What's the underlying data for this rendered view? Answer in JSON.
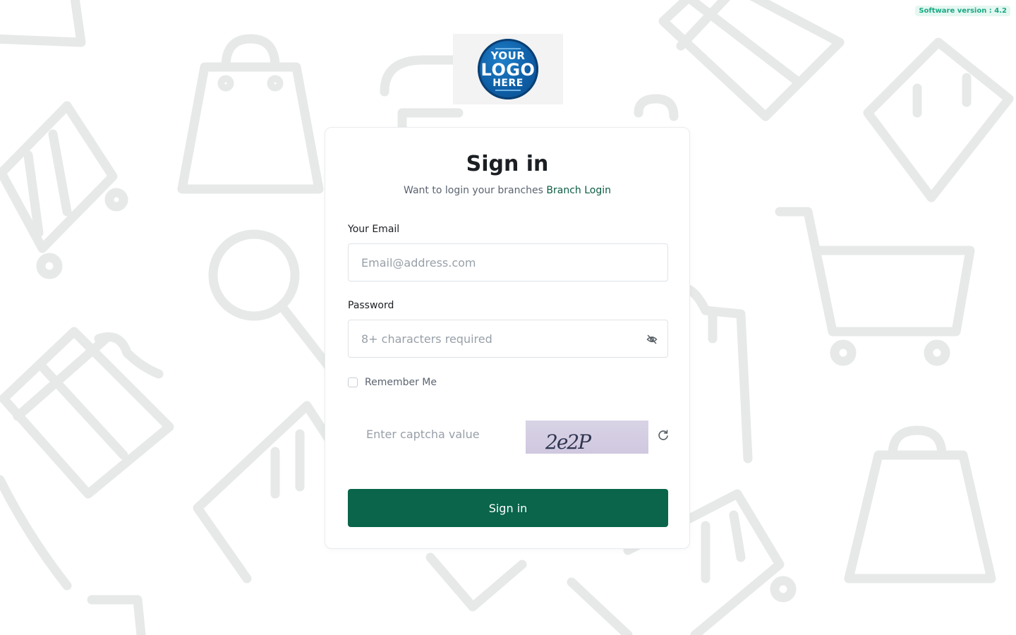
{
  "version_badge": "Software version : 4.2",
  "logo": {
    "line1": "YOUR",
    "line2": "LOGO",
    "line3": "HERE"
  },
  "signin_form": {
    "title": "Sign in",
    "subtitle": "Want to login your branches",
    "branch_link": "Branch Login",
    "email_label": "Your Email",
    "email_placeholder": "Email@address.com",
    "email_value": "",
    "password_label": "Password",
    "password_placeholder": "8+ characters required",
    "password_value": "",
    "remember_label": "Remember Me",
    "remember_checked": false,
    "captcha_placeholder": "Enter captcha value",
    "captcha_text": "2e2P",
    "submit_label": "Sign in"
  },
  "icons": {
    "password_toggle": "eye-slash-icon",
    "captcha_refresh": "refresh-icon"
  },
  "colors": {
    "primary": "#0a654a",
    "link": "#0a5c43",
    "badge_bg": "#e4f7f1",
    "badge_text": "#19a983",
    "background_pattern": "#e6e9e8"
  }
}
